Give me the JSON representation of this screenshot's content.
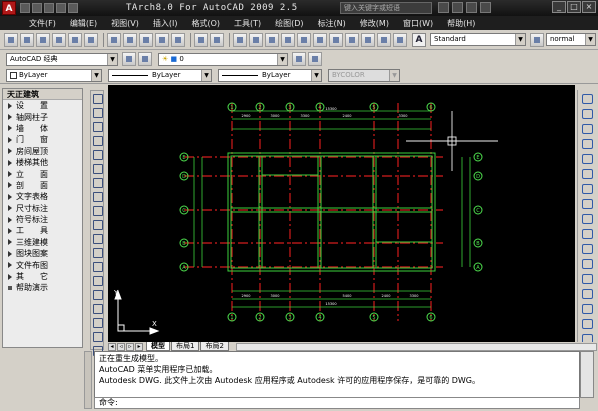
{
  "titlebar": {
    "logo": "A",
    "title": "TArch8.0 For AutoCAD 2009 2.5",
    "search_placeholder": "键入关键字或短语"
  },
  "menu": [
    "文件(F)",
    "编辑(E)",
    "视图(V)",
    "插入(I)",
    "格式(O)",
    "工具(T)",
    "绘图(D)",
    "标注(N)",
    "修改(M)",
    "窗口(W)",
    "帮助(H)"
  ],
  "toolbar": {
    "text_style": "Standard",
    "dim_style": "normal",
    "style_icon": "A"
  },
  "workspace": {
    "value": "AutoCAD 经典"
  },
  "layer": {
    "value": "0"
  },
  "properties": {
    "color": "ByLayer",
    "linetype": "ByLayer",
    "lineweight": "ByLayer",
    "plotstyle": "BYCOLOR"
  },
  "palette": {
    "title": "天正建筑",
    "items": [
      "设　　置",
      "轴网柱子",
      "墙　　体",
      "门　　窗",
      "房间屋顶",
      "楼梯其他",
      "立　　面",
      "剖　　面",
      "文字表格",
      "尺寸标注",
      "符号标注",
      "工　　具",
      "三维建模",
      "图块图案",
      "文件布图",
      "其　　它",
      "帮助演示"
    ]
  },
  "drawing": {
    "top_axes": [
      "1",
      "2",
      "3",
      "4",
      "5",
      "6"
    ],
    "left_axes": [
      "E",
      "D",
      "C",
      "B",
      "A"
    ],
    "top_dims": [
      "2900",
      "3000",
      "3300",
      "2400",
      "3300"
    ],
    "top_total": "15300",
    "bottom_dims": [
      "2900",
      "3000",
      "5400",
      "2400",
      "3300"
    ],
    "bottom_total": "15300",
    "ucs_x": "X",
    "ucs_y": "Y"
  },
  "tabs": {
    "items": [
      "模型",
      "布局1",
      "布局2"
    ],
    "active": "模型"
  },
  "command": {
    "lines": [
      "正在重生成模型。",
      "AutoCAD 菜单实用程序已加载。",
      "Autodesk DWG.  此文件上次由 Autodesk 应用程序或 Autodesk 许可的应用程序保存，是可靠的 DWG。"
    ],
    "prompt": "命令:"
  },
  "colors": {
    "axis_red": "#d21c1c",
    "wall_green": "#3cd23c",
    "bubble": "#4fe14f",
    "crosshair": "#f0f0f0"
  }
}
